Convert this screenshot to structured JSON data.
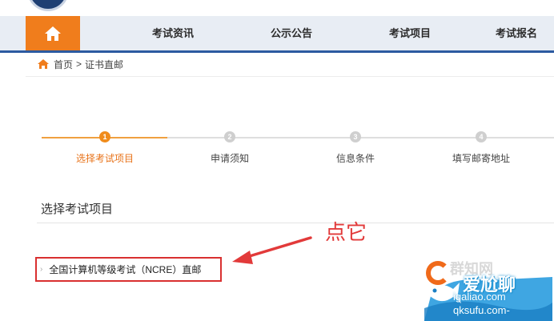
{
  "nav": {
    "items": [
      "考试资讯",
      "公示公告",
      "考试项目",
      "考试报名"
    ]
  },
  "breadcrumb": {
    "home": "首页",
    "separator": ">",
    "current": "证书直邮"
  },
  "steps": [
    {
      "number": "1",
      "label": "选择考试项目",
      "state": "active"
    },
    {
      "number": "2",
      "label": "申请须知",
      "state": "idle"
    },
    {
      "number": "3",
      "label": "信息条件",
      "state": "idle"
    },
    {
      "number": "4",
      "label": "填写邮寄地址",
      "state": "idle"
    }
  ],
  "section": {
    "title": "选择考试项目"
  },
  "exam_item": {
    "chevron": "›",
    "label": "全国计算机等级考试（NCRE）直邮"
  },
  "annotation": {
    "text": "点它"
  },
  "watermark": {
    "ghost": "群知网",
    "line1": "爱尬聊",
    "line2": "igaliao.com",
    "line3": "qksufu.com-"
  },
  "colors": {
    "accent_orange": "#f07d1c",
    "nav_blue": "#2c5aa0",
    "annotation_red": "#e23a3a"
  }
}
